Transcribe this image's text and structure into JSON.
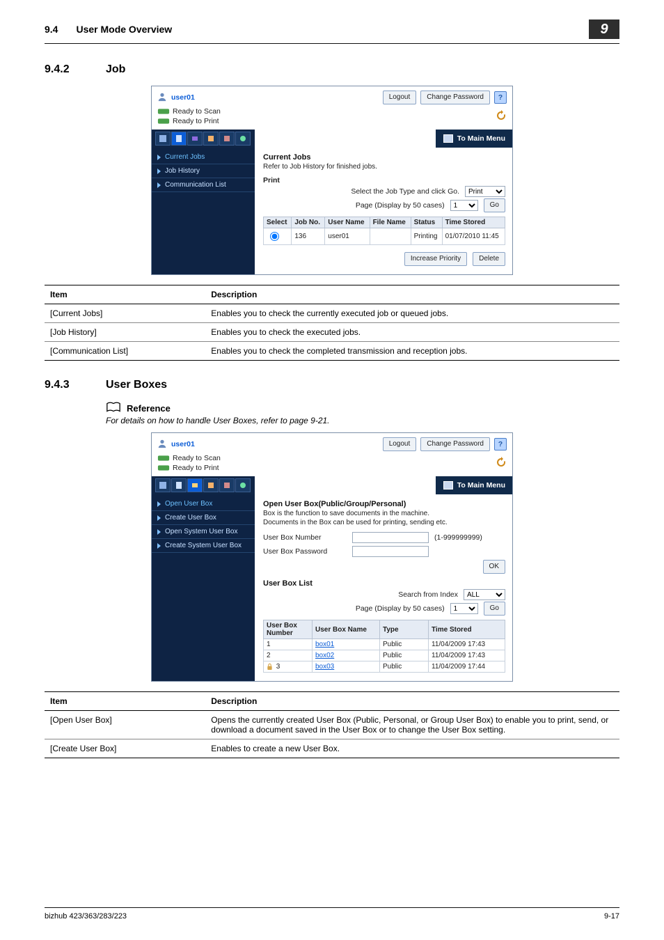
{
  "header": {
    "secnum": "9.4",
    "sectitle": "User Mode Overview",
    "corner": "9"
  },
  "sec1": {
    "num": "9.4.2",
    "title": "Job"
  },
  "sec2": {
    "num": "9.4.3",
    "title": "User Boxes"
  },
  "reference": {
    "label": "Reference",
    "note": "For details on how to handle User Boxes, refer to page 9-21."
  },
  "table_headers": {
    "item": "Item",
    "desc": "Description"
  },
  "table1": {
    "rows": [
      {
        "item": "[Current Jobs]",
        "desc": "Enables you to check the currently executed job or queued jobs."
      },
      {
        "item": "[Job History]",
        "desc": "Enables you to check the executed jobs."
      },
      {
        "item": "[Communication List]",
        "desc": "Enables you to check the completed transmission and reception jobs."
      }
    ]
  },
  "table2": {
    "rows": [
      {
        "item": "[Open User Box]",
        "desc": "Opens the currently created User Box (Public, Personal, or Group User Box) to enable you to print, send, or download a document saved in the User Box or to change the User Box setting."
      },
      {
        "item": "[Create User Box]",
        "desc": "Enables to create a new User Box."
      }
    ]
  },
  "shot1": {
    "user": "user01",
    "logout": "Logout",
    "change_pw": "Change Password",
    "help": "?",
    "status_scan": "Ready to Scan",
    "status_print": "Ready to Print",
    "tomain": "To Main Menu",
    "side": {
      "current": "Current Jobs",
      "history": "Job History",
      "comm": "Communication List"
    },
    "main_title": "Current Jobs",
    "sub1": "Refer to Job History for finished jobs.",
    "print_label": "Print",
    "line_select": "Select the Job Type and click Go.",
    "line_page": "Page (Display by 50 cases)",
    "sel_print": "Print",
    "sel_page": "1",
    "go": "Go",
    "tbl": {
      "h_sel": "Select",
      "h_jobno": "Job No.",
      "h_user": "User Name",
      "h_file": "File Name",
      "h_status": "Status",
      "h_time": "Time Stored",
      "row": {
        "jobno": "136",
        "user": "user01",
        "file": "",
        "status": "Printing",
        "time": "01/07/2010 11:45"
      }
    },
    "btn_priority": "Increase Priority",
    "btn_delete": "Delete"
  },
  "shot2": {
    "user": "user01",
    "logout": "Logout",
    "change_pw": "Change Password",
    "help": "?",
    "status_scan": "Ready to Scan",
    "status_print": "Ready to Print",
    "tomain": "To Main Menu",
    "side": {
      "open": "Open User Box",
      "create": "Create User Box",
      "openSys": "Open System User Box",
      "createSys": "Create System User Box"
    },
    "main_title": "Open User Box(Public/Group/Personal)",
    "sub1": "Box is the function to save documents in the machine.",
    "sub2": "Documents in the Box can be used for printing, sending etc.",
    "ubn_label": "User Box Number",
    "ubn_range": "(1-999999999)",
    "ubp_label": "User Box Password",
    "ok": "OK",
    "list_title": "User Box List",
    "search_label": "Search from Index",
    "page_label": "Page (Display by 50 cases)",
    "search_sel": "ALL",
    "page_sel": "1",
    "go": "Go",
    "tbl": {
      "h_num": "User Box Number",
      "h_name": "User Box Name",
      "h_type": "Type",
      "h_time": "Time Stored",
      "rows": [
        {
          "num": "1",
          "name": "box01",
          "type": "Public",
          "time": "11/04/2009 17:43",
          "locked": false
        },
        {
          "num": "2",
          "name": "box02",
          "type": "Public",
          "time": "11/04/2009 17:43",
          "locked": false
        },
        {
          "num": "3",
          "name": "box03",
          "type": "Public",
          "time": "11/04/2009 17:44",
          "locked": true
        }
      ]
    }
  },
  "footer": {
    "model": "bizhub 423/363/283/223",
    "pageno": "9-17"
  }
}
